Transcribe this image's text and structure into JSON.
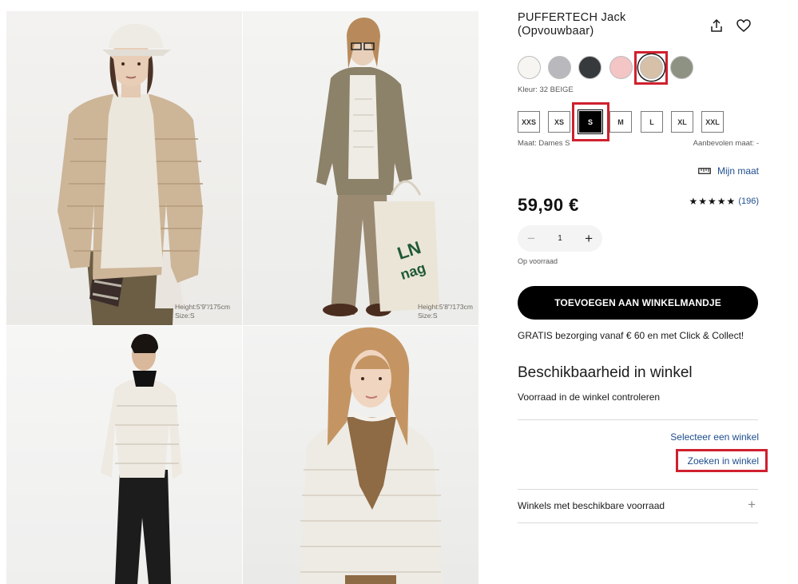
{
  "gallery": {
    "photos": [
      {
        "caption_height": "Height:5'9\"/175cm",
        "caption_size": "Size:S"
      },
      {
        "caption_height": "Height:5'8\"/173cm",
        "caption_size": "Size:S"
      },
      {},
      {}
    ],
    "bag_text": "LN nag"
  },
  "product": {
    "title": "PUFFERTECH Jack (Opvouwbaar)",
    "share_icon": "share-icon",
    "wishlist_icon": "heart-icon",
    "colors": [
      {
        "name": "off-white",
        "hex": "#f7f5f1"
      },
      {
        "name": "grey",
        "hex": "#b9b8bd"
      },
      {
        "name": "dark-grey",
        "hex": "#373a3d"
      },
      {
        "name": "pink",
        "hex": "#f3c5c5"
      },
      {
        "name": "beige",
        "hex": "#d6c0a8",
        "selected": true
      },
      {
        "name": "olive",
        "hex": "#8d9283"
      }
    ],
    "color_label": "Kleur: 32 BEIGE",
    "sizes": [
      "XXS",
      "XS",
      "S",
      "M",
      "L",
      "XL",
      "XXL"
    ],
    "selected_size": "S",
    "size_label": "Maat: Dames S",
    "recommended_label": "Aanbevolen maat: -",
    "my_size_link": "Mijn maat",
    "price": "59,90 €",
    "stars": "★★★★★",
    "reviews": "(196)",
    "quantity": "1",
    "stock_status": "Op voorraad",
    "add_to_cart": "TOEVOEGEN AAN WINKELMANDJE",
    "shipping_note": "GRATIS bezorging vanaf € 60 en met Click & Collect!"
  },
  "store": {
    "title": "Beschikbaarheid in winkel",
    "subtitle": "Voorraad in de winkel controleren",
    "select_store": "Selecteer een winkel",
    "search_store": "Zoeken in winkel",
    "stores_with_stock": "Winkels met beschikbare voorraad",
    "expand_icon": "plus-icon"
  },
  "colors": {
    "link": "#1f4e8c",
    "highlight": "#d0202e",
    "button": "#000000"
  }
}
